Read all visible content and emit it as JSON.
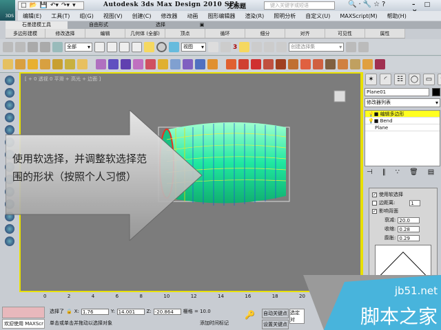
{
  "titlebar": {
    "app_title": "Autodesk 3ds Max Design 2010 SP1",
    "document": "无标题",
    "search_placeholder": "键入关键字或短语",
    "logo_text": "3DS",
    "search_icons": "🔍·🔧☆?",
    "window_controls": "– □ ×"
  },
  "quick_access": [
    "□",
    "📂",
    "💾",
    "↶▾",
    "↷▾",
    "▾"
  ],
  "menu": [
    "编辑(E)",
    "工具(T)",
    "组(G)",
    "视图(V)",
    "创建(C)",
    "修改器",
    "动画",
    "图形编辑器",
    "渲染(R)",
    "照明分析",
    "自定义(U)",
    "MAXScript(M)",
    "帮助(H)"
  ],
  "ribbon": {
    "tabs": [
      "石墨建模工具",
      "自由形式",
      "选择",
      "▣"
    ],
    "panels": [
      "多边形建模",
      "修改选择",
      "编辑",
      "几何体 (全部)",
      "顶点",
      "循环",
      "细分",
      "对齐",
      "可见性",
      "属性"
    ]
  },
  "toolbar": {
    "selection_filter": "全部",
    "reference_coord": "视图",
    "named_selection": "创建选择集",
    "snap_label": "3"
  },
  "viewport": {
    "label": "[ + 0 透视 0 平滑 + 高光 + 边面 ]",
    "callout_text": "使用软选择，并调整软选择范围的形状（按照个人习惯）",
    "accent": "#e8e000"
  },
  "command_panel": {
    "object_name": "Plane01",
    "modifier_list": "修改器列表",
    "stack": [
      "编辑多边形",
      "Bend",
      "Plane"
    ],
    "soft_selection": {
      "use_soft_selection": "使用软选择",
      "edge_distance": "边距离:",
      "edge_distance_value": "1",
      "affect_backfacing": "影响背面",
      "falloff_label": "衰减:",
      "falloff": "20.0",
      "pinch_label": "收缩:",
      "pinch": "0.28",
      "bubble_label": "膨胀:",
      "bubble": "0.29"
    }
  },
  "timeline": {
    "ticks": [
      "0",
      "2",
      "4",
      "6",
      "8",
      "10",
      "12",
      "14",
      "16",
      "18",
      "20"
    ]
  },
  "status": {
    "selected": "选择了",
    "x_label": "X:",
    "x": "1.76",
    "y_label": "Y:",
    "y": "14.001",
    "z_label": "Z:",
    "z": "-20.864",
    "grid": "栅格 = 10.0",
    "prompt": "单击或单击并拖动以选择对象",
    "add_time_tag": "添加时间标记",
    "auto_key": "自动关键点",
    "set_key": "设置关键点",
    "selected_set": "选定对",
    "welcome": "欢迎使用 MAXScr"
  },
  "watermark": {
    "url": "jb51.net",
    "name": "脚本之家"
  }
}
